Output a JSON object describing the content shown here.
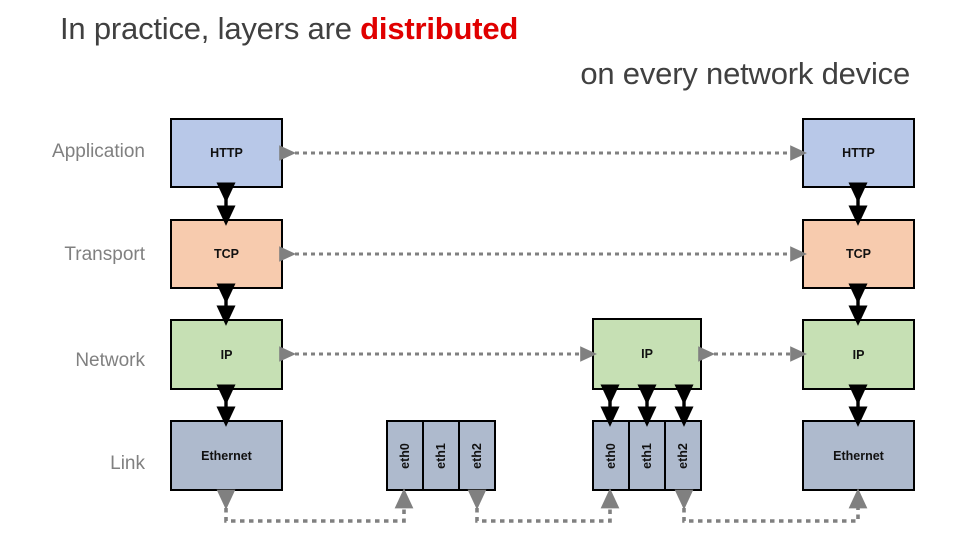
{
  "title": {
    "line1_prefix": "In practice, layers are ",
    "line1_emphasis": "distributed",
    "line2": "on every network device",
    "emphasis_color": "#e00000",
    "text_color": "#404040"
  },
  "layers": [
    {
      "name": "Application",
      "label": "Application"
    },
    {
      "name": "Transport",
      "label": "Transport"
    },
    {
      "name": "Network",
      "label": "Network"
    },
    {
      "name": "Link",
      "label": "Link"
    }
  ],
  "palette": {
    "application": "#b8c8e8",
    "transport": "#f7cbae",
    "network": "#c6e0b4",
    "link": "#aebacd",
    "border": "#000000",
    "solid_arrow": "#000000",
    "dotted_arrow": "#808080"
  },
  "hosts": {
    "left_host": {
      "name": "left-host",
      "boxes": [
        {
          "layer": "Application",
          "label": "HTTP",
          "color": "application"
        },
        {
          "layer": "Transport",
          "label": "TCP",
          "color": "transport"
        },
        {
          "layer": "Network",
          "label": "IP",
          "color": "network"
        },
        {
          "layer": "Link",
          "label": "Ethernet",
          "color": "link"
        }
      ]
    },
    "middle_switch": {
      "name": "middle-switch",
      "interfaces": [
        "eth0",
        "eth1",
        "eth2"
      ]
    },
    "middle_router": {
      "name": "middle-router",
      "boxes": [
        {
          "layer": "Network",
          "label": "IP",
          "color": "network"
        }
      ],
      "interfaces": [
        "eth0",
        "eth1",
        "eth2"
      ]
    },
    "right_host": {
      "name": "right-host",
      "boxes": [
        {
          "layer": "Application",
          "label": "HTTP",
          "color": "application"
        },
        {
          "layer": "Transport",
          "label": "TCP",
          "color": "transport"
        },
        {
          "layer": "Network",
          "label": "IP",
          "color": "network"
        },
        {
          "layer": "Link",
          "label": "Ethernet",
          "color": "link"
        }
      ]
    }
  },
  "peer_links": [
    {
      "name": "application-peer-link",
      "layer": "Application",
      "from": "left HTTP",
      "to": "right HTTP",
      "style": "dotted-double-arrow"
    },
    {
      "name": "transport-peer-link",
      "layer": "Transport",
      "from": "left TCP",
      "to": "right TCP",
      "style": "dotted-double-arrow"
    },
    {
      "name": "network-peer-link-left",
      "layer": "Network",
      "from": "left IP",
      "to": "router IP",
      "style": "dotted-double-arrow"
    },
    {
      "name": "network-peer-link-right",
      "layer": "Network",
      "from": "router IP",
      "to": "right IP",
      "style": "dotted-double-arrow"
    }
  ],
  "physical_links": [
    {
      "name": "link-left-to-switch",
      "from": "left Ethernet",
      "to": "switch eth0",
      "style": "dotted-double-arrow"
    },
    {
      "name": "link-switch-to-router",
      "from": "switch eth2",
      "to": "router eth0",
      "style": "dotted-double-arrow"
    },
    {
      "name": "link-router-to-right",
      "from": "router eth2",
      "to": "right Ethernet",
      "style": "dotted-double-arrow"
    }
  ]
}
